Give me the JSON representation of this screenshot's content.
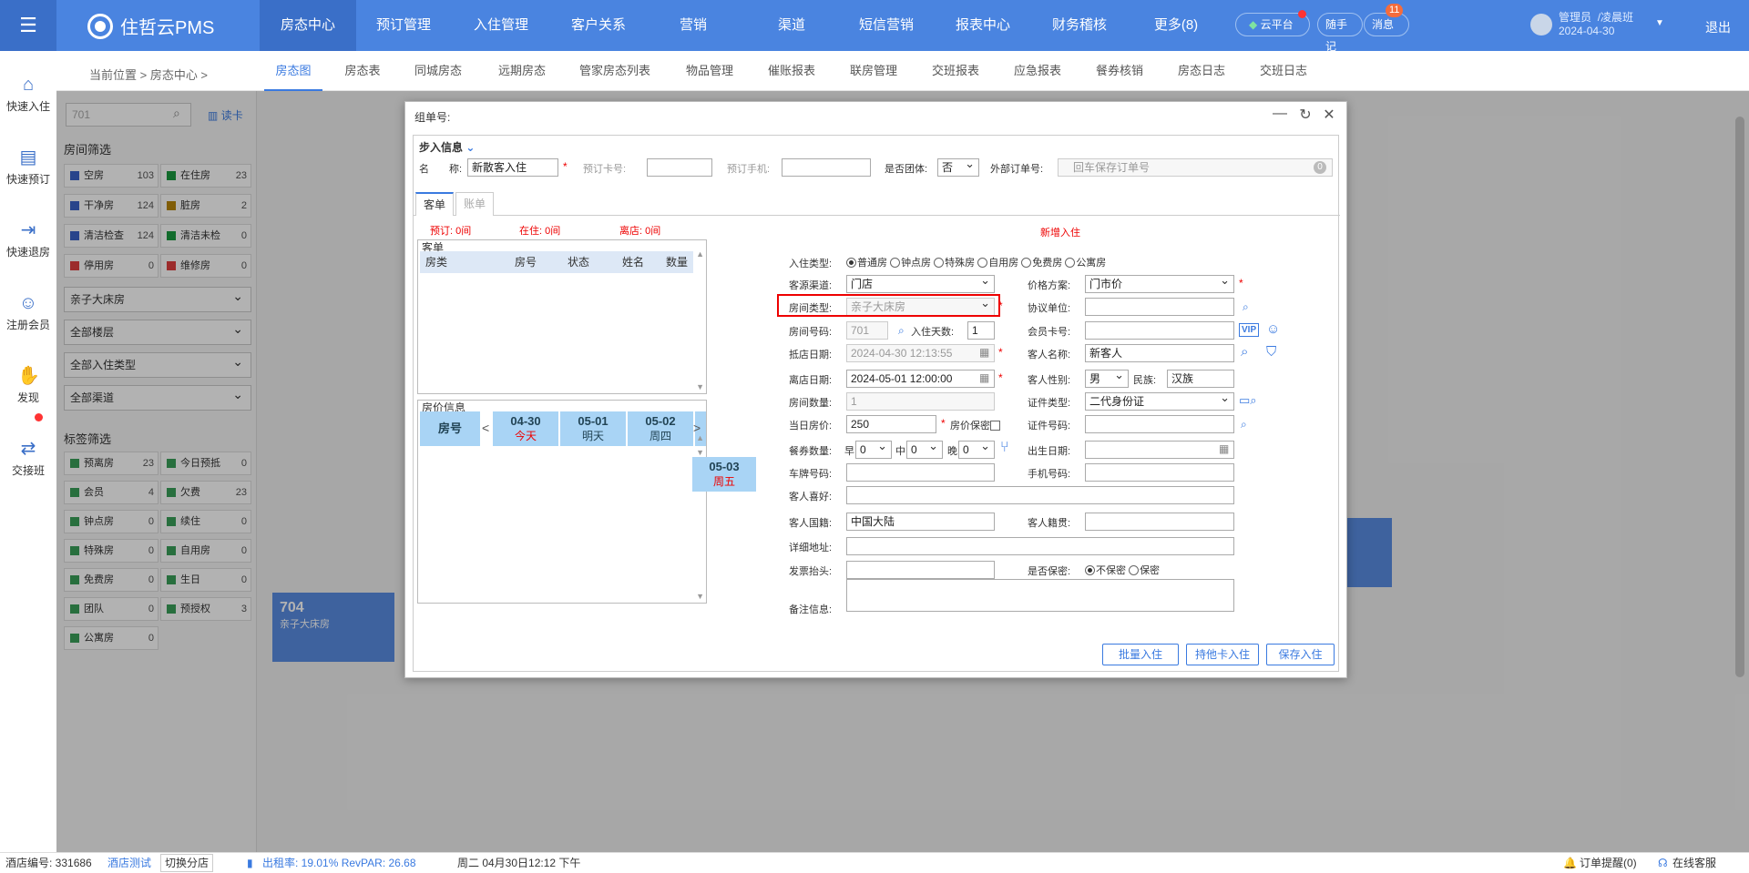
{
  "app": {
    "title": "住哲云PMS"
  },
  "topnav": {
    "items": [
      "房态中心",
      "预订管理",
      "入住管理",
      "客户关系",
      "营销",
      "渠道",
      "短信营销",
      "报表中心",
      "财务稽核",
      "更多(8)"
    ],
    "cloud": "云平台",
    "notes": "随手记",
    "messages": "消息",
    "message_count": "11",
    "user_role": "管理员",
    "user_name": "/凌晨班",
    "user_date": "2024-04-30",
    "logout": "退出"
  },
  "sidebar": {
    "items": [
      "快速入住",
      "快速预订",
      "快速退房",
      "注册会员",
      "发现",
      "交接班"
    ]
  },
  "breadcrumb": "当前位置 > 房态中心 >",
  "subtabs": [
    "房态图",
    "房态表",
    "同城房态",
    "远期房态",
    "管家房态列表",
    "物品管理",
    "催账报表",
    "联房管理",
    "交班报表",
    "应急报表",
    "餐券核销",
    "房态日志",
    "交班日志"
  ],
  "leftpanel": {
    "search_value": "701",
    "read_card": "读卡",
    "room_filter_title": "房间筛选",
    "filters": [
      {
        "name": "空房",
        "count": "103",
        "color": "#3a62c8"
      },
      {
        "name": "在住房",
        "count": "23",
        "color": "#1a9a40"
      },
      {
        "name": "干净房",
        "count": "124",
        "color": "#3a62c8"
      },
      {
        "name": "脏房",
        "count": "2",
        "color": "#b8860b"
      },
      {
        "name": "清洁检查",
        "count": "124",
        "color": "#3a62c8"
      },
      {
        "name": "清洁未检",
        "count": "0",
        "color": "#1a9a40"
      },
      {
        "name": "停用房",
        "count": "0",
        "color": "#e04040"
      },
      {
        "name": "维修房",
        "count": "0",
        "color": "#e04040"
      }
    ],
    "selects": [
      "亲子大床房",
      "全部楼层",
      "全部入住类型",
      "全部渠道"
    ],
    "tag_title": "标签筛选",
    "tags": [
      {
        "name": "预离房",
        "count": "23"
      },
      {
        "name": "今日预抵",
        "count": "0"
      },
      {
        "name": "会员",
        "count": "4"
      },
      {
        "name": "欠费",
        "count": "23"
      },
      {
        "name": "钟点房",
        "count": "0"
      },
      {
        "name": "续住",
        "count": "0"
      },
      {
        "name": "特殊房",
        "count": "0"
      },
      {
        "name": "自用房",
        "count": "0"
      },
      {
        "name": "免费房",
        "count": "0"
      },
      {
        "name": "生日",
        "count": "0"
      },
      {
        "name": "团队",
        "count": "0"
      },
      {
        "name": "预授权",
        "count": "3"
      },
      {
        "name": "公寓房",
        "count": "0"
      }
    ]
  },
  "room_tile": {
    "number": "704",
    "type": "亲子大床房"
  },
  "footer": {
    "hotel_no": "酒店编号: 331686",
    "hotel_name": "酒店测试",
    "switch": "切换分店",
    "occupancy": "出租率: 19.01% RevPAR: 26.68",
    "datetime": "周二 04月30日12:12 下午",
    "order_alert": "订单提醒(0)",
    "support": "在线客服"
  },
  "dialog": {
    "title": "组单号:",
    "step_title": "步入信息",
    "name_label": "名　　称:",
    "name_value": "新散客入住",
    "card_label": "预订卡号:",
    "phone_label": "预订手机:",
    "group_label": "是否团体:",
    "group_value": "否",
    "ext_label": "外部订单号:",
    "ext_placeholder": "回车保存订单号",
    "ext_count": "0",
    "tabs": [
      "客单",
      "账单"
    ],
    "stats": {
      "reserve": "预订: 0间",
      "staying": "在住: 0间",
      "leaving": "离店: 0间"
    },
    "new_checkin": "新增入住",
    "guest_list": {
      "title": "客单",
      "columns": [
        "房类",
        "房号",
        "状态",
        "姓名",
        "数量"
      ]
    },
    "price_info": {
      "title": "房价信息",
      "room_label": "房号",
      "dates": [
        {
          "date": "04-30",
          "day": "今天"
        },
        {
          "date": "05-01",
          "day": "明天"
        },
        {
          "date": "05-02",
          "day": "周四"
        },
        {
          "date": "05-03",
          "day": "周五"
        }
      ]
    },
    "form": {
      "checkin_type_label": "入住类型:",
      "checkin_types": [
        "普通房",
        "钟点房",
        "特殊房",
        "自用房",
        "免费房",
        "公寓房"
      ],
      "source_label": "客源渠道:",
      "source_value": "门店",
      "price_plan_label": "价格方案:",
      "price_plan_value": "门市价",
      "room_type_label": "房间类型:",
      "room_type_value": "亲子大床房",
      "agreement_label": "协议单位:",
      "room_no_label": "房间号码:",
      "room_no_value": "701",
      "stay_days_label": "入住天数:",
      "stay_days_value": "1",
      "member_card_label": "会员卡号:",
      "vip": "VIP",
      "arrive_label": "抵店日期:",
      "arrive_value": "2024-04-30 12:13:55",
      "guest_name_label": "客人名称:",
      "guest_name_value": "新客人",
      "leave_label": "离店日期:",
      "leave_value": "2024-05-01 12:00:00",
      "gender_label": "客人性别:",
      "gender_value": "男",
      "nation_label": "民族:",
      "nation_value": "汉族",
      "room_count_label": "房间数量:",
      "room_count_value": "1",
      "id_type_label": "证件类型:",
      "id_type_value": "二代身份证",
      "price_label": "当日房价:",
      "price_value": "250",
      "price_secret_label": "房价保密",
      "id_no_label": "证件号码:",
      "meal_label": "餐券数量:",
      "breakfast": "早",
      "lunch": "中",
      "dinner": "晚",
      "meal_b": "0",
      "meal_l": "0",
      "meal_d": "0",
      "birth_label": "出生日期:",
      "plate_label": "车牌号码:",
      "mobile_label": "手机号码:",
      "preference_label": "客人喜好:",
      "country_label": "客人国籍:",
      "country_value": "中国大陆",
      "native_label": "客人籍贯:",
      "address_label": "详细地址:",
      "invoice_label": "发票抬头:",
      "secret_label": "是否保密:",
      "secret_no": "不保密",
      "secret_yes": "保密",
      "remark_label": "备注信息:"
    },
    "buttons": {
      "batch": "批量入住",
      "other_card": "持他卡入住",
      "save": "保存入住"
    }
  }
}
